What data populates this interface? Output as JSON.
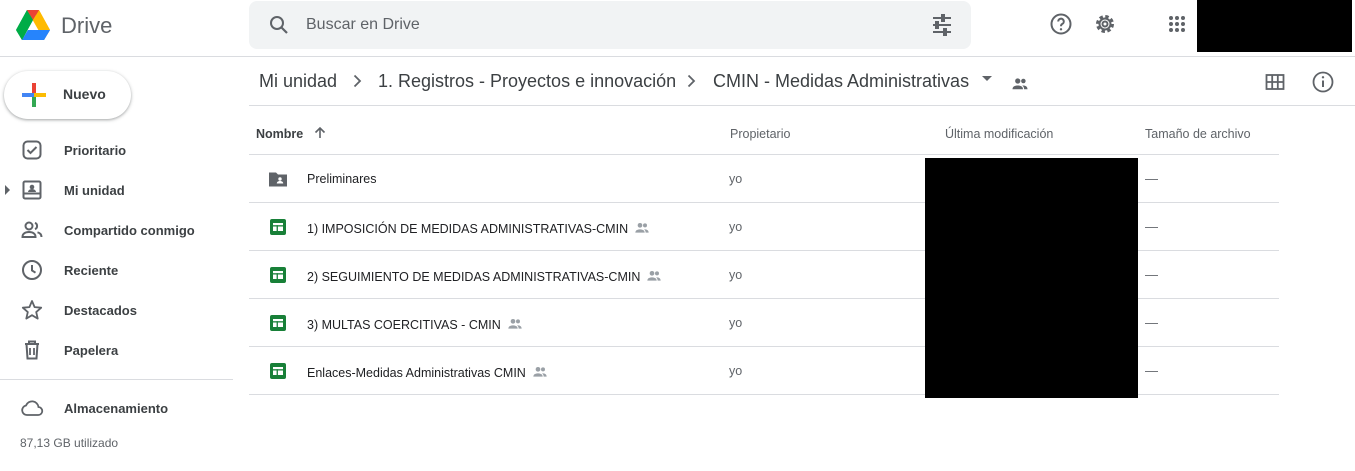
{
  "app": {
    "name": "Drive"
  },
  "search": {
    "placeholder": "Buscar en Drive",
    "value": ""
  },
  "header": {
    "search_icon": "search-icon",
    "tune_icon": "tune-icon",
    "help_icon": "help-icon",
    "settings_icon": "gear-icon",
    "apps_icon": "apps-grid-icon"
  },
  "sidebar": {
    "new_label": "Nuevo",
    "items": [
      {
        "label": "Prioritario",
        "icon": "priority-icon"
      },
      {
        "label": "Mi unidad",
        "icon": "my-drive-icon"
      },
      {
        "label": "Compartido conmigo",
        "icon": "shared-with-me-icon"
      },
      {
        "label": "Reciente",
        "icon": "clock-icon"
      },
      {
        "label": "Destacados",
        "icon": "star-icon"
      },
      {
        "label": "Papelera",
        "icon": "trash-icon"
      }
    ],
    "storage": {
      "label": "Almacenamiento",
      "icon": "cloud-icon",
      "used": "87,13 GB utilizado"
    }
  },
  "breadcrumb": {
    "items": [
      "Mi unidad",
      "1. Registros - Proyectos e innovación",
      "CMIN - Medidas Administrativas"
    ]
  },
  "table": {
    "columns": {
      "name": "Nombre",
      "owner": "Propietario",
      "modified": "Última modificación",
      "size": "Tamaño de archivo"
    },
    "rows": [
      {
        "name": "Preliminares",
        "type": "shared-folder",
        "shared": false,
        "owner": "yo",
        "size": "—"
      },
      {
        "name": "1) IMPOSICIÓN DE MEDIDAS ADMINISTRATIVAS-CMIN",
        "type": "sheet",
        "shared": true,
        "owner": "yo",
        "size": "—"
      },
      {
        "name": "2) SEGUIMIENTO DE MEDIDAS ADMINISTRATIVAS-CMIN",
        "type": "sheet",
        "shared": true,
        "owner": "yo",
        "size": "—"
      },
      {
        "name": "3) MULTAS COERCITIVAS - CMIN",
        "type": "sheet",
        "shared": true,
        "owner": "yo",
        "size": "—"
      },
      {
        "name": "Enlaces-Medidas Administrativas CMIN",
        "type": "sheet",
        "shared": true,
        "owner": "yo",
        "size": "—"
      }
    ]
  },
  "colors": {
    "sheet_green": "#188038",
    "icon_gray": "#5f6368",
    "border": "#dadce0",
    "search_bg": "#f1f3f4"
  }
}
